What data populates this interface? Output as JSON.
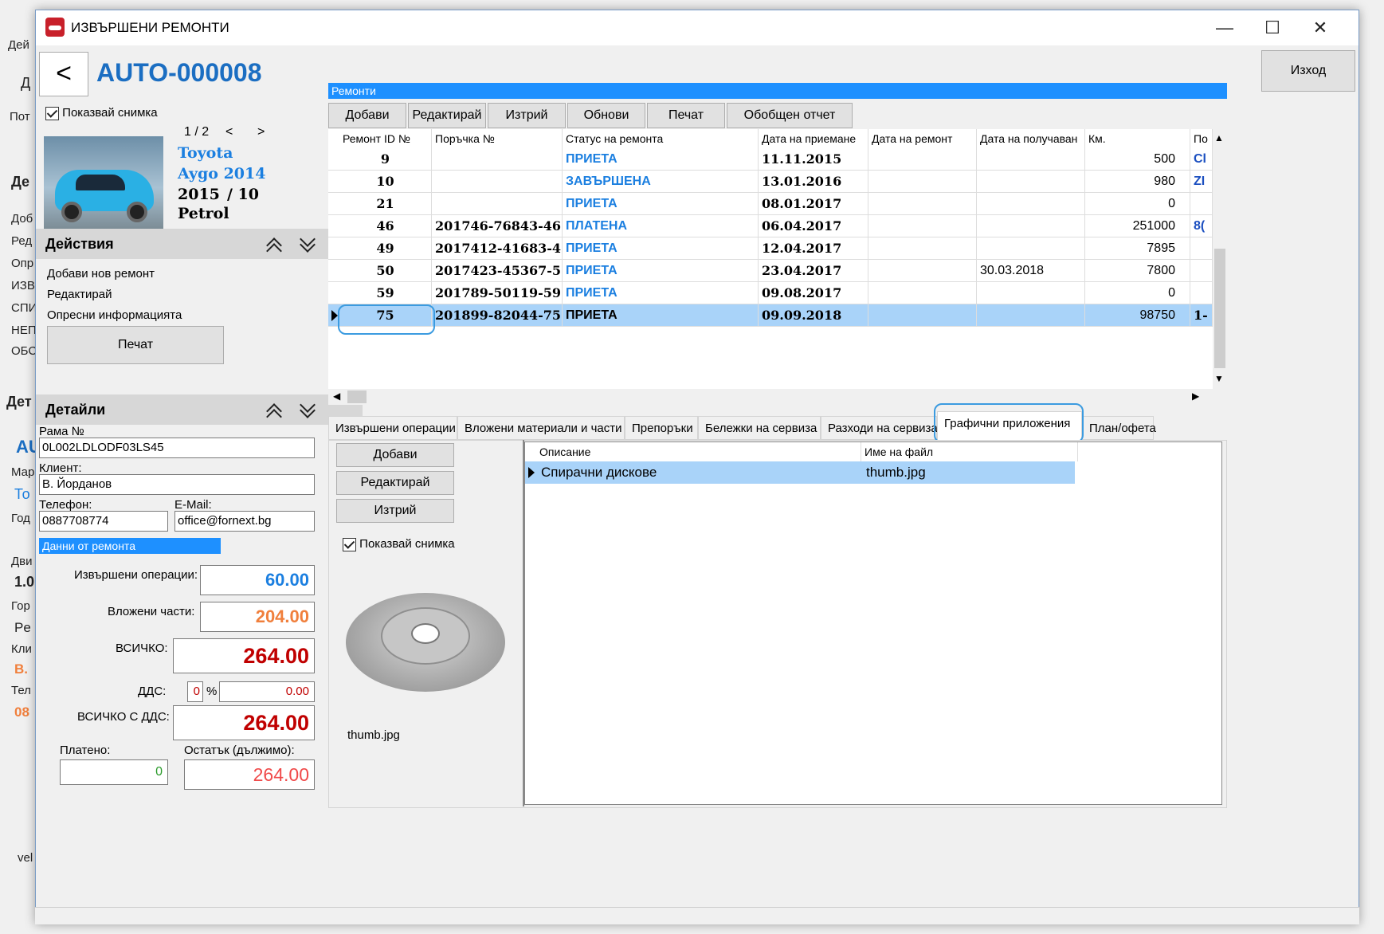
{
  "window": {
    "title": "ИЗВЪРШЕНИ РЕМОНТИ",
    "min_label": "—",
    "max_label": "☐",
    "close_label": "✕",
    "back_label": "<",
    "record_id": "AUTO-000008",
    "exit_label": "Изход"
  },
  "background_app": {
    "labels": [
      "Дей",
      "Д",
      "Пот",
      "Де",
      "Доб",
      "Ред",
      "Опр",
      "ИЗВ",
      "СПИ",
      "НЕП",
      "ОБС",
      "Дет",
      "AU",
      "Мар",
      "То",
      "Год",
      "Дви",
      "1.0",
      "Гор",
      "Pe",
      "Кли",
      "В.",
      "Тел",
      "08",
      "vel"
    ]
  },
  "vehicle": {
    "show_photo_label": "Показвай снимка",
    "photo_counter": "1 / 2",
    "prev": "<",
    "next": ">",
    "make": "Toyota",
    "model": "Aygo 2014",
    "year": "2015",
    "month": "/ 10",
    "fuel": "Petrol"
  },
  "actions": {
    "header": "Действия",
    "items": [
      "Добави нов ремонт",
      "Редактирай",
      "Опресни информацията"
    ],
    "print": "Печат"
  },
  "details": {
    "header": "Детайли",
    "frame_label": "Рама №",
    "frame_value": "0L002LDLODF03LS45",
    "client_label": "Клиент:",
    "client_value": "В. Йорданов",
    "phone_label": "Телефон:",
    "phone_value": "0887708774",
    "email_label": "E-Mail:",
    "email_value": "office@fornext.bg",
    "repair_data_label": "Данни от ремонта",
    "ops_label": "Извършени операции:",
    "ops_value": "60.00",
    "parts_label": "Вложени части:",
    "parts_value": "204.00",
    "total_label": "ВСИЧКО:",
    "total_value": "264.00",
    "vat_label": "ДДС:",
    "vat_pct": "0",
    "vat_sign": "%",
    "vat_value": "0.00",
    "total_vat_label": "ВСИЧКО С ДДС:",
    "total_vat_value": "264.00",
    "paid_label": "Платено:",
    "paid_value": "0",
    "remaining_label": "Остатък (дължимо):",
    "remaining_value": "264.00"
  },
  "repairs": {
    "strip_label": "Ремонти",
    "toolbar": [
      "Добави",
      "Редактирай",
      "Изтрий",
      "Обнови",
      "Печат",
      "Обобщен отчет"
    ],
    "columns": [
      "Ремонт ID №",
      "Поръчка №",
      "Статус на ремонта",
      "Дата на приемане",
      "Дата на ремонт",
      "Дата на получаван",
      "Км.",
      "По"
    ],
    "rows": [
      {
        "id": "9",
        "order": "",
        "status": "ПРИЕТА",
        "accepted": "11.11.2015",
        "repair": "",
        "received": "",
        "km": "500",
        "extra": "Cl"
      },
      {
        "id": "10",
        "order": "",
        "status": "ЗАВЪРШЕНА",
        "accepted": "13.01.2016",
        "repair": "",
        "received": "",
        "km": "980",
        "extra": "ZI"
      },
      {
        "id": "21",
        "order": "",
        "status": "ПРИЕТА",
        "accepted": "08.01.2017",
        "repair": "",
        "received": "",
        "km": "0",
        "extra": ""
      },
      {
        "id": "46",
        "order": "201746-76843-46",
        "status": "ПЛАТЕНА",
        "accepted": "06.04.2017",
        "repair": "",
        "received": "",
        "km": "251000",
        "extra": "8("
      },
      {
        "id": "49",
        "order": "2017412-41683-4",
        "status": "ПРИЕТА",
        "accepted": "12.04.2017",
        "repair": "",
        "received": "",
        "km": "7895",
        "extra": ""
      },
      {
        "id": "50",
        "order": "2017423-45367-5",
        "status": "ПРИЕТА",
        "accepted": "23.04.2017",
        "repair": "",
        "received": "30.03.2018",
        "km": "7800",
        "extra": ""
      },
      {
        "id": "59",
        "order": "201789-50119-59",
        "status": "ПРИЕТА",
        "accepted": "09.08.2017",
        "repair": "",
        "received": "",
        "km": "0",
        "extra": ""
      },
      {
        "id": "75",
        "order": "201899-82044-75",
        "status": "ПРИЕТА",
        "accepted": "09.09.2018",
        "repair": "",
        "received": "",
        "km": "98750",
        "extra": "1-"
      }
    ]
  },
  "tabs": [
    "Извършени операции",
    "Вложени материали и части",
    "Препоръки",
    "Бележки на сервиза",
    "Разходи на сервиза",
    "Графични приложения",
    "План/офета"
  ],
  "attachments": {
    "buttons": [
      "Добави",
      "Редактирай",
      "Изтрий"
    ],
    "show_photo_label": "Показвай снимка",
    "preview_caption": "thumb.jpg",
    "columns": [
      "Описание",
      "Име на файл"
    ],
    "rows": [
      {
        "description": "Спирачни дискове",
        "filename": "thumb.jpg"
      }
    ]
  },
  "colors": {
    "accent": "#1e90ff",
    "status_blue": "#1b7fe0",
    "selection": "#a9d3f9",
    "orange": "#f07f3c",
    "red": "#c00000"
  }
}
